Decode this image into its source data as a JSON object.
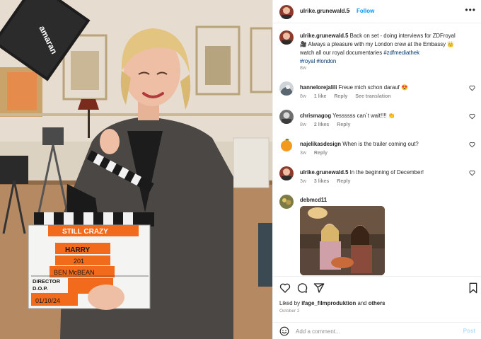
{
  "post": {
    "username": "ulrike.grunewald.5",
    "separator": "•",
    "follow_label": "Follow",
    "more_label": "•••"
  },
  "caption": {
    "username": "ulrike.grunewald.5",
    "line1": "Back on set - doing interviews for ZDFroyal",
    "line2": "🎥 Always a pleasure with my London crew at the Embassy 👑",
    "line3": "watch all our royal documentaries",
    "tag_zdf": "#zdfmediathek",
    "tag_royal": "#royal",
    "tag_london": "#london",
    "time": "8w"
  },
  "comments": [
    {
      "username": "hannelorejalili",
      "text": "Freue mich schon darauf 😍",
      "time": "8w",
      "likes": "1 like",
      "reply": "Reply",
      "extra": "See translation"
    },
    {
      "username": "chrismagog",
      "text": "Yessssss can´t wait!!!! 👏",
      "time": "8w",
      "likes": "2 likes",
      "reply": "Reply",
      "extra": ""
    },
    {
      "username": "najelikasdesign",
      "text": "When is the trailer coming out?",
      "time": "3w",
      "likes": "",
      "reply": "Reply",
      "extra": ""
    },
    {
      "username": "ulrike.grunewald.5",
      "text": "In the beginning of December!",
      "time": "3w",
      "likes": "3 likes",
      "reply": "Reply",
      "extra": ""
    }
  ],
  "gif_comment": {
    "username": "debmcd11"
  },
  "photo": {
    "light_brand": "amaran",
    "clapper": {
      "title": "STILL CRAZY",
      "roll": "HARRY",
      "scene": "201",
      "dop_name": "BEN McBEAN",
      "director_label": "DIRECTOR",
      "dop_label": "D.O.P.",
      "date": "01/10/24"
    }
  },
  "actions": {
    "liked_prefix": "Liked by",
    "liked_user": "ifage_filmproduktion",
    "liked_and": "and",
    "liked_others": "others",
    "date": "October 2"
  },
  "add_comment": {
    "placeholder": "Add a comment...",
    "post_label": "Post"
  },
  "colors": {
    "link_blue": "#0095f6",
    "hashtag": "#00376b",
    "muted": "#8e8e8e",
    "clapper_orange": "#f26a1b"
  }
}
